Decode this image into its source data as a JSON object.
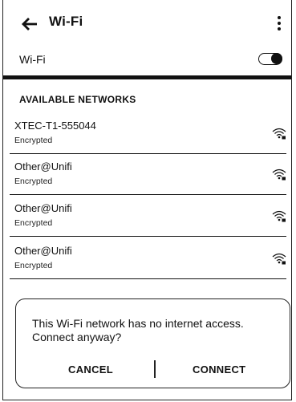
{
  "header": {
    "title": "Wi-Fi"
  },
  "wifi": {
    "label": "Wi-Fi",
    "enabled": true
  },
  "section_title": "AVAILABLE NETWORKS",
  "networks": [
    {
      "name": "XTEC-T1-555044",
      "security": "Encrypted",
      "icon": "wifi-locked-icon"
    },
    {
      "name": "Other@Unifi",
      "security": "Encrypted",
      "icon": "wifi-locked-icon"
    },
    {
      "name": "Other@Unifi",
      "security": "Encrypted",
      "icon": "wifi-locked-icon"
    },
    {
      "name": "Other@Unifi",
      "security": "Encrypted",
      "icon": "wifi-locked-icon"
    }
  ],
  "dialog": {
    "message": "This Wi-Fi network has no internet access. Connect anyway?",
    "cancel_label": "CANCEL",
    "connect_label": "CONNECT"
  }
}
